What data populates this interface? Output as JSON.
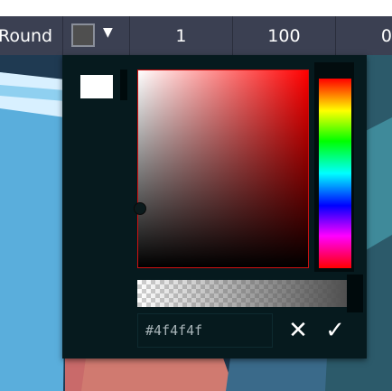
{
  "toolbar": {
    "cap_label": "Round",
    "color_value": "#4f4f4f",
    "dropdown_caret": "▼",
    "field_1": "1",
    "field_2": "100",
    "field_3": "0"
  },
  "color_picker": {
    "hex_value": "#4f4f4f",
    "hue": "red",
    "preview_color": "#ffffff",
    "cancel_symbol": "✕",
    "confirm_symbol": "✓",
    "alpha_bar_color": "#4f4f4f"
  }
}
